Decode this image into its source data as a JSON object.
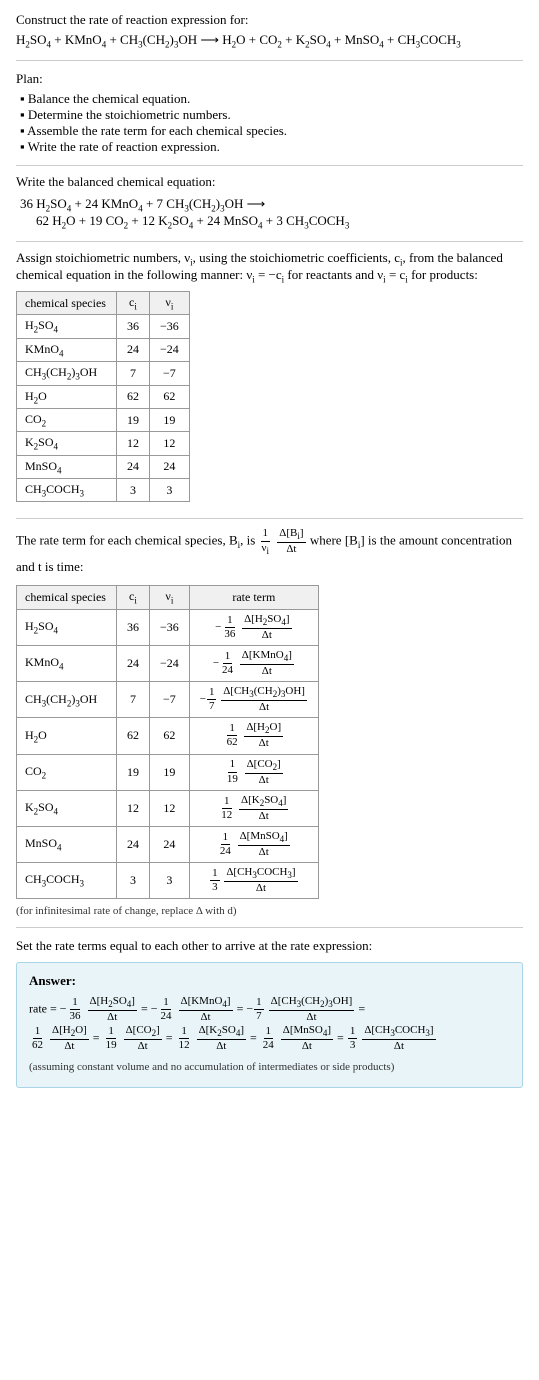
{
  "header": {
    "construct_label": "Construct the rate of reaction expression for:",
    "reaction": "H₂SO₄ + KMnO₄ + CH₃(CH₂)₃OH ⟶ H₂O + CO₂ + K₂SO₄ + MnSO₄ + CH₃COCH₃"
  },
  "plan": {
    "title": "Plan:",
    "items": [
      "Balance the chemical equation.",
      "Determine the stoichiometric numbers.",
      "Assemble the rate term for each chemical species.",
      "Write the rate of reaction expression."
    ]
  },
  "balanced": {
    "label": "Write the balanced chemical equation:",
    "equation_line1": "36 H₂SO₄ + 24 KMnO₄ + 7 CH₃(CH₂)₃OH ⟶",
    "equation_line2": "62 H₂O + 19 CO₂ + 12 K₂SO₄ + 24 MnSO₄ + 3 CH₃COCH₃"
  },
  "stoich": {
    "intro": "Assign stoichiometric numbers, νᵢ, using the stoichiometric coefficients, cᵢ, from the balanced chemical equation in the following manner: νᵢ = −cᵢ for reactants and νᵢ = cᵢ for products:",
    "col_species": "chemical species",
    "col_ci": "cᵢ",
    "col_vi": "νᵢ",
    "rows": [
      {
        "species": "H₂SO₄",
        "ci": "36",
        "vi": "−36"
      },
      {
        "species": "KMnO₄",
        "ci": "24",
        "vi": "−24"
      },
      {
        "species": "CH₃(CH₂)₃OH",
        "ci": "7",
        "vi": "−7"
      },
      {
        "species": "H₂O",
        "ci": "62",
        "vi": "62"
      },
      {
        "species": "CO₂",
        "ci": "19",
        "vi": "19"
      },
      {
        "species": "K₂SO₄",
        "ci": "12",
        "vi": "12"
      },
      {
        "species": "MnSO₄",
        "ci": "24",
        "vi": "24"
      },
      {
        "species": "CH₃COCH₃",
        "ci": "3",
        "vi": "3"
      }
    ]
  },
  "rate_term": {
    "intro_part1": "The rate term for each chemical species, Bᵢ, is",
    "intro_frac": "1/νᵢ · Δ[Bᵢ]/Δt",
    "intro_part2": "where [Bᵢ] is the amount concentration and t is time:",
    "col_species": "chemical species",
    "col_ci": "cᵢ",
    "col_vi": "νᵢ",
    "col_rate": "rate term",
    "rows": [
      {
        "species": "H₂SO₄",
        "ci": "36",
        "vi": "−36",
        "rate": "−1/36 · Δ[H₂SO₄]/Δt"
      },
      {
        "species": "KMnO₄",
        "ci": "24",
        "vi": "−24",
        "rate": "−1/24 · Δ[KMnO₄]/Δt"
      },
      {
        "species": "CH₃(CH₂)₃OH",
        "ci": "7",
        "vi": "−7",
        "rate": "−1/7 · Δ[CH₃(CH₂)₃OH]/Δt"
      },
      {
        "species": "H₂O",
        "ci": "62",
        "vi": "62",
        "rate": "1/62 · Δ[H₂O]/Δt"
      },
      {
        "species": "CO₂",
        "ci": "19",
        "vi": "19",
        "rate": "1/19 · Δ[CO₂]/Δt"
      },
      {
        "species": "K₂SO₄",
        "ci": "12",
        "vi": "12",
        "rate": "1/12 · Δ[K₂SO₄]/Δt"
      },
      {
        "species": "MnSO₄",
        "ci": "24",
        "vi": "24",
        "rate": "1/24 · Δ[MnSO₄]/Δt"
      },
      {
        "species": "CH₃COCH₃",
        "ci": "3",
        "vi": "3",
        "rate": "1/3 · Δ[CH₃COCH₃]/Δt"
      }
    ],
    "note": "(for infinitesimal rate of change, replace Δ with d)"
  },
  "final": {
    "set_equal": "Set the rate terms equal to each other to arrive at the rate expression:",
    "answer_label": "Answer:",
    "rate_label": "rate =",
    "note": "(assuming constant volume and no accumulation of intermediates or side products)"
  }
}
